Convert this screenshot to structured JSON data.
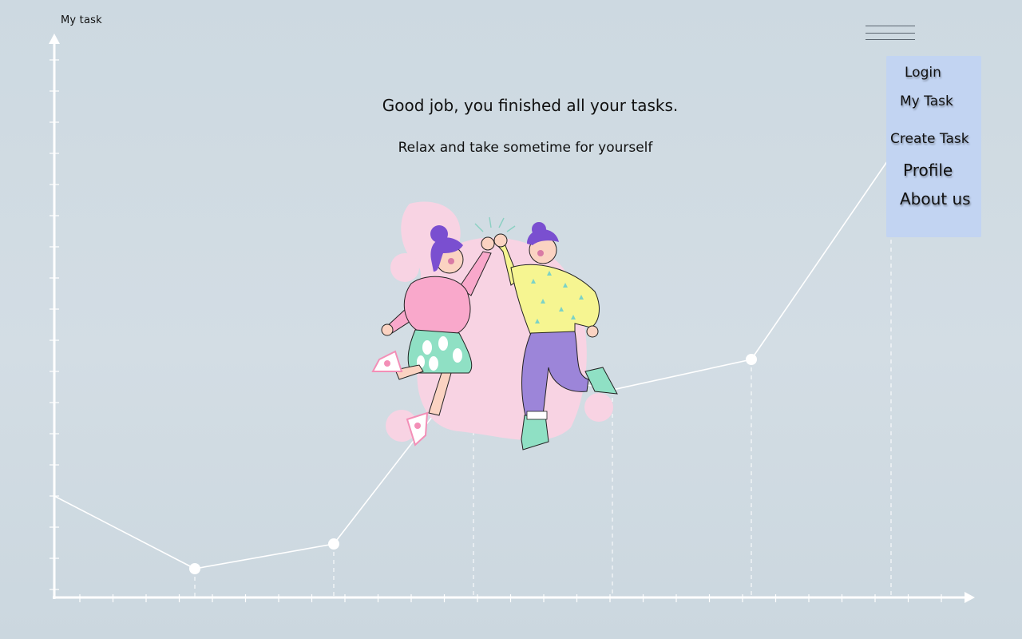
{
  "header": {
    "app_title": "My task"
  },
  "menu": {
    "items": [
      {
        "label": "Login",
        "icon": "none"
      },
      {
        "label": "My Task"
      },
      {
        "label": "Create Task"
      },
      {
        "label": "Profile"
      },
      {
        "label": "About us"
      }
    ]
  },
  "main": {
    "headline": "Good job, you finished all your tasks.",
    "subline": "Relax and take sometime for yourself"
  },
  "colors": {
    "background": "#cfdae2",
    "menu_bg": "#c2d4f2",
    "graph_line": "#ffffff",
    "blob": "#f8d3e3"
  },
  "icons": {
    "menu_toggle": "hamburger-menu-icon",
    "illustration": "high-five-illustration"
  }
}
